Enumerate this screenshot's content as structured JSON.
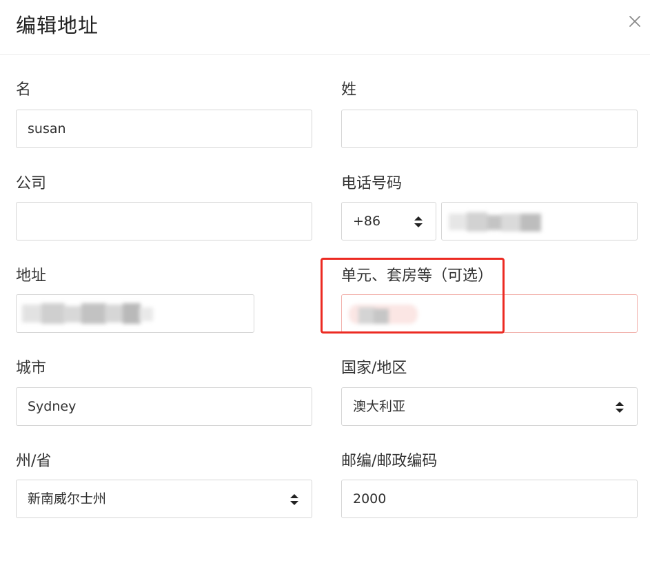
{
  "dialog": {
    "title": "编辑地址",
    "close_icon": "close-icon"
  },
  "form": {
    "first_name": {
      "label": "名",
      "value": "susan"
    },
    "last_name": {
      "label": "姓",
      "value": ""
    },
    "company": {
      "label": "公司",
      "value": ""
    },
    "phone": {
      "label": "电话号码",
      "country_code": "+86",
      "number": ""
    },
    "address": {
      "label": "地址",
      "value": ""
    },
    "apartment": {
      "label": "单元、套房等（可选）",
      "value": ""
    },
    "city": {
      "label": "城市",
      "value": "Sydney"
    },
    "country": {
      "label": "国家/地区",
      "value": "澳大利亚"
    },
    "state": {
      "label": "州/省",
      "value": "新南威尔士州"
    },
    "postcode": {
      "label": "邮编/邮政编码",
      "value": "2000"
    }
  },
  "colors": {
    "border": "#d6d6d6",
    "error_border": "#f2b3ae",
    "highlight_annotation": "#ec2a22",
    "text": "#212121"
  }
}
